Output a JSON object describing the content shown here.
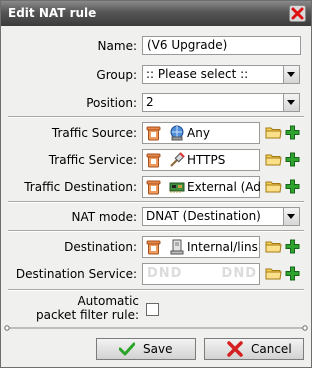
{
  "window": {
    "title": "Edit NAT rule"
  },
  "form": {
    "name_label": "Name:",
    "name_value": "(V6 Upgrade)",
    "group_label": "Group:",
    "group_value": ":: Please select ::",
    "position_label": "Position:",
    "position_value": "2",
    "traffic_source_label": "Traffic Source:",
    "traffic_source_value": "Any",
    "traffic_service_label": "Traffic Service:",
    "traffic_service_value": "HTTPS",
    "traffic_destination_label": "Traffic Destination:",
    "traffic_destination_value": "External (Ad",
    "nat_mode_label": "NAT mode:",
    "nat_mode_value": "DNAT (Destination)",
    "destination_label": "Destination:",
    "destination_value": "Internal/lins",
    "destination_service_label": "Destination Service:",
    "dnd_placeholder": "DND",
    "auto_pf_label_line1": "Automatic",
    "auto_pf_label_line2": "packet filter rule:",
    "auto_pf_checked": false
  },
  "buttons": {
    "save": "Save",
    "cancel": "Cancel"
  },
  "colors": {
    "titlebar": "#4a4a4a",
    "add_green": "#2a9a2a",
    "folder_yellow": "#f2c94c",
    "trash_orange": "#e07a3c"
  }
}
